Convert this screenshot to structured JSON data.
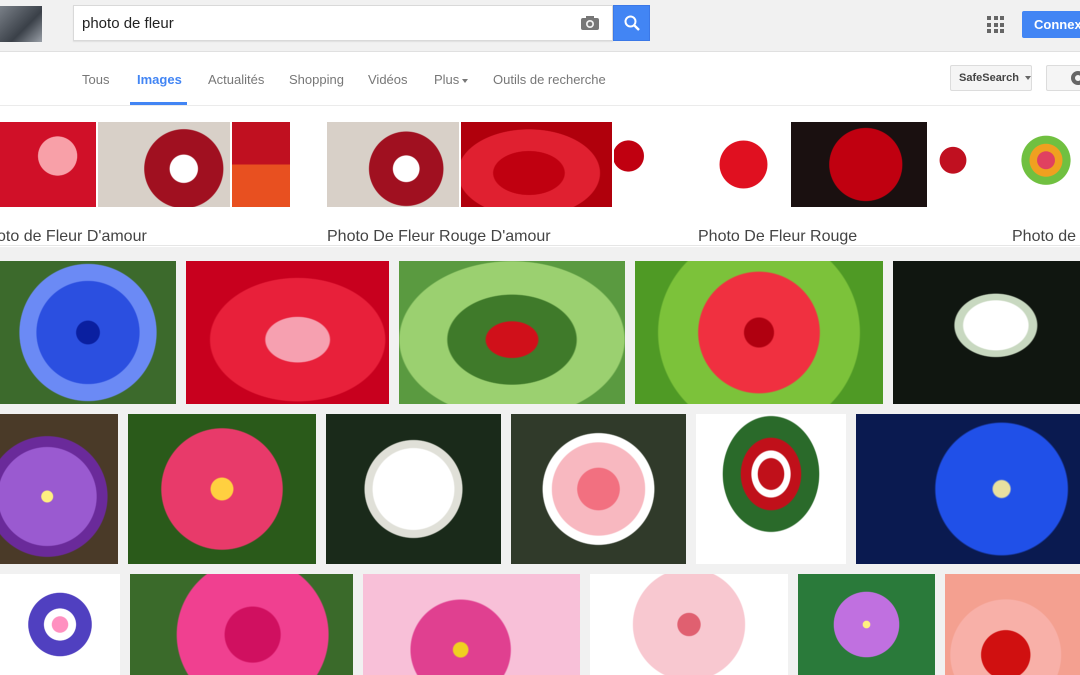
{
  "search": {
    "query": "photo de fleur"
  },
  "header": {
    "signin_label": "Connex"
  },
  "tabs": [
    {
      "label": "Tous"
    },
    {
      "label": "Images"
    },
    {
      "label": "Actualités"
    },
    {
      "label": "Shopping"
    },
    {
      "label": "Vidéos"
    },
    {
      "label": "Plus"
    },
    {
      "label": "Outils de recherche"
    }
  ],
  "active_tab": "Images",
  "toolbar": {
    "safesearch_label": "SafeSearch"
  },
  "related_searches": [
    {
      "label": "oto de Fleur D'amour"
    },
    {
      "label": "Photo De Fleur Rouge D'amour"
    },
    {
      "label": "Photo De Fleur Rouge"
    },
    {
      "label": "Photo de"
    }
  ],
  "icons": [
    "camera-icon",
    "search-icon",
    "apps-grid-icon",
    "gear-icon",
    "chevron-down-icon"
  ],
  "colors": {
    "accent": "#4285f4",
    "header_bg": "#f1f1f1",
    "tab_text": "#777777",
    "label_text": "#444444"
  }
}
